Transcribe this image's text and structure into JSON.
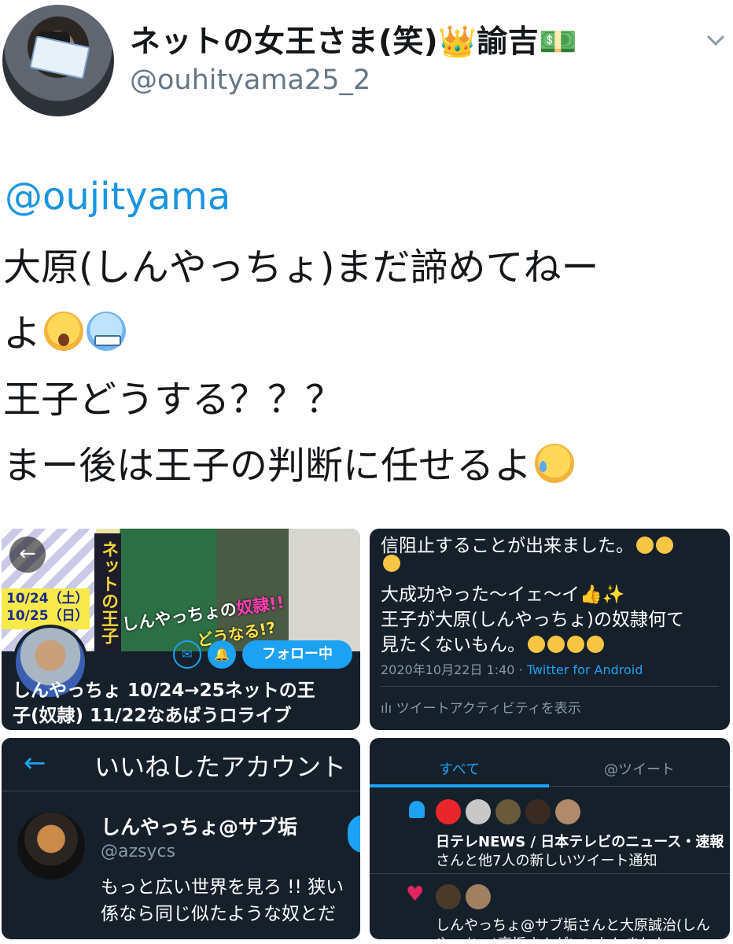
{
  "tweet": {
    "author_name": "ネットの女王さま(笑)👑諭吉💵",
    "author_handle": "@ouhityama25_2",
    "mention": "@oujityama",
    "lines": [
      "大原(しんやっちょ)まだ諦めてねー",
      "よ",
      "王子どうする？？？",
      "まー後は王子の判断に任せるよ"
    ],
    "emoji": [
      "scream-face-emoji",
      "cold-face-emoji",
      "crying-face-emoji"
    ]
  },
  "media": {
    "profile_card": {
      "vertical_title": "ネットの王子",
      "dates": [
        "10/24（土）",
        "10/25（日）"
      ],
      "promo_prefix": "しんやっちょの",
      "promo_highlight": "奴隷!!",
      "promo_question": "どうなる!?",
      "follow_label": "フォロー中",
      "profile_name_line1": "しんやっちょ 10/24→25ネットの王",
      "profile_name_line2": "子(奴隷) 11/22なあばうロライブ"
    },
    "tweet_detail": {
      "lines": [
        "信阻止することが出来ました。",
        "",
        "大成功やった〜イェ〜イ👍✨",
        "王子が大原(しんやっちょ)の奴隷何て",
        "見たくないもん。"
      ],
      "timestamp": "2020年10月22日 1:40 · ",
      "source": "Twitter for Android",
      "activity_label": "ツイートアクティビティを表示"
    },
    "likes_list": {
      "title": "いいねしたアカウント",
      "user_name": "しんやっちょ@サブ垢",
      "user_handle": "@azsycs",
      "bio_lines": [
        "もっと広い世界を見ろ !! 狭い",
        "係なら同じ似たような奴とだ"
      ]
    },
    "notifications": {
      "tab_all": "すべて",
      "tab_tweets": "@ツイート",
      "item1_line1": "日テレNEWS / 日本テレビのニュース・速報",
      "item1_line2": "さんと他7人の新しいツイート通知",
      "item2_line1": "しんやっちょ@サブ垢さんと大原誠治(しん",
      "item2_line2": "やっちょ)裏垢さんがいいねしました"
    }
  },
  "colors": {
    "link": "#1b95e0",
    "dark_bg": "#15202b",
    "accent": "#1da1f2",
    "heart": "#e0245e"
  }
}
